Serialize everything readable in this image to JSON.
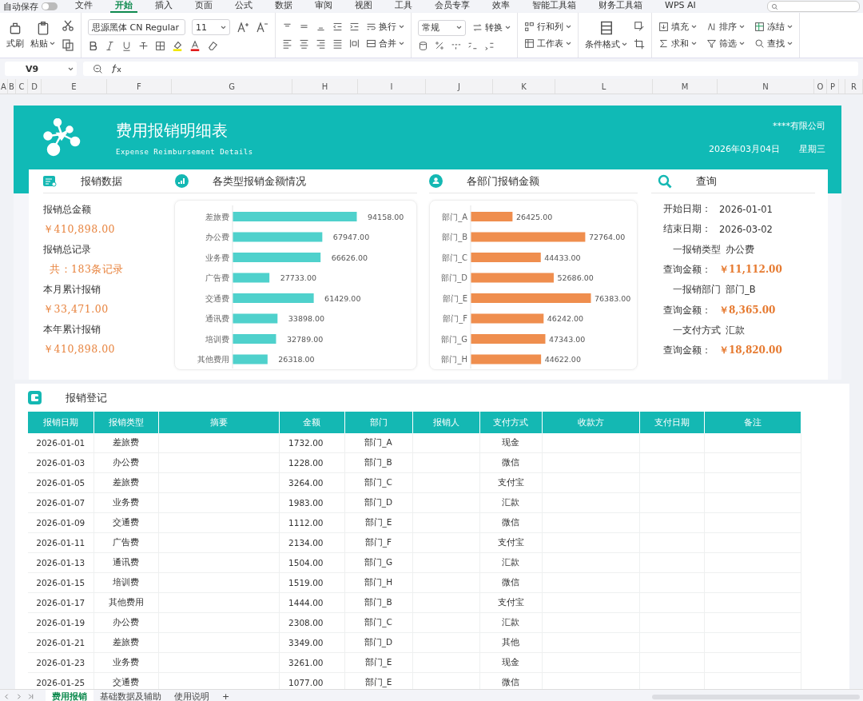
{
  "menu": {
    "autosave": {
      "label": "自动保存",
      "on": false
    },
    "tabs": [
      {
        "label": "文件",
        "selected": false
      },
      {
        "label": "开始",
        "selected": true
      },
      {
        "label": "插入",
        "selected": false
      },
      {
        "label": "页面",
        "selected": false
      },
      {
        "label": "公式",
        "selected": false
      },
      {
        "label": "数据",
        "selected": false
      },
      {
        "label": "审阅",
        "selected": false
      },
      {
        "label": "视图",
        "selected": false
      },
      {
        "label": "工具",
        "selected": false
      },
      {
        "label": "会员专享",
        "selected": false
      },
      {
        "label": "效率",
        "selected": false
      },
      {
        "label": "智能工具箱",
        "selected": false
      },
      {
        "label": "财务工具箱",
        "selected": false
      },
      {
        "label": "WPS AI",
        "selected": false
      }
    ]
  },
  "ribbon": {
    "format_painter": "式刷",
    "paste": "粘贴",
    "font": "思源黑体 CN Regular",
    "size": "11",
    "wrap": "换行",
    "merge": "合并",
    "number_format": "常规",
    "convert": "转换",
    "rows_cols": "行和列",
    "worksheet": "工作表",
    "conditional": "条件格式",
    "fill": "填充",
    "sort": "排序",
    "freeze": "冻结",
    "sum": "求和",
    "filter": "筛选",
    "find": "查找"
  },
  "formula_bar": {
    "cell": "V9"
  },
  "columns": [
    "A",
    "B",
    "C",
    "D",
    "E",
    "F",
    "G",
    "H",
    "I",
    "J",
    "K",
    "L",
    "M",
    "N",
    "O",
    "P",
    "R"
  ],
  "header": {
    "title": "费用报销明细表",
    "subtitle": "Expense Reimbursement Details",
    "company": "****有限公司",
    "date": "2026年03月04日",
    "weekday": "星期三"
  },
  "sections": [
    "报销数据",
    "各类型报销金额情况",
    "各部门报销金额",
    "查询"
  ],
  "stats": [
    {
      "label": "报销总金额",
      "value": "￥410,898.00"
    },
    {
      "label": "报销总记录",
      "value": "共：183条记录"
    },
    {
      "label": "本月累计报销",
      "value": "￥33,471.00"
    },
    {
      "label": "本年累计报销",
      "value": "￥410,898.00"
    }
  ],
  "type_chart": {
    "chart_data": {
      "type": "bar",
      "orientation": "horizontal",
      "categories": [
        "差旅费",
        "办公费",
        "业务费",
        "广告费",
        "交通费",
        "通讯费",
        "培训费",
        "其他费用"
      ],
      "series": [
        {
          "color": "#4fd1cc",
          "values": [
            94158,
            67947,
            66626,
            27733,
            61429,
            33898,
            32789,
            26318
          ],
          "value_labels": [
            "94158.00",
            "67947.00",
            "66626.00",
            "27733.00",
            "61429.00",
            "33898.00",
            "32789.00",
            "26318.00"
          ]
        }
      ]
    }
  },
  "dept_chart": {
    "chart_data": {
      "type": "bar",
      "orientation": "horizontal",
      "categories": [
        "部门_A",
        "部门_B",
        "部门_C",
        "部门_D",
        "部门_E",
        "部门_F",
        "部门_G",
        "部门_H"
      ],
      "series": [
        {
          "color": "#ef8e4e",
          "values": [
            26425,
            72764,
            44433,
            52686,
            76383,
            46242,
            47343,
            44622
          ],
          "value_labels": [
            "26425.00",
            "72764.00",
            "44433.00",
            "52686.00",
            "76383.00",
            "46242.00",
            "47343.00",
            "44622.00"
          ]
        }
      ]
    }
  },
  "query": [
    {
      "kind": "field",
      "label": "开始日期：",
      "value": "2026-01-01"
    },
    {
      "kind": "field",
      "label": "结束日期：",
      "value": "2026-03-02"
    },
    {
      "kind": "filter",
      "label": "一报销类型",
      "value": "办公费"
    },
    {
      "kind": "amount",
      "label": "查询金额：",
      "value": "￥11,112.00"
    },
    {
      "kind": "filter",
      "label": "一报销部门",
      "value": "部门_B"
    },
    {
      "kind": "amount",
      "label": "查询金额：",
      "value": "￥8,365.00"
    },
    {
      "kind": "filter",
      "label": "一支付方式",
      "value": "汇款"
    },
    {
      "kind": "amount",
      "label": "查询金额：",
      "value": "￥18,820.00"
    }
  ],
  "register": {
    "title": "报销登记",
    "columns": [
      "报销日期",
      "报销类型",
      "摘要",
      "金额",
      "部门",
      "报销人",
      "支付方式",
      "收款方",
      "支付日期",
      "备注"
    ],
    "rows": [
      {
        "date": "2026-01-01",
        "type": "差旅费",
        "amount": "1732.00",
        "dept": "部门_A",
        "pay": "现金"
      },
      {
        "date": "2026-01-03",
        "type": "办公费",
        "amount": "1228.00",
        "dept": "部门_B",
        "pay": "微信"
      },
      {
        "date": "2026-01-05",
        "type": "差旅费",
        "amount": "3264.00",
        "dept": "部门_C",
        "pay": "支付宝"
      },
      {
        "date": "2026-01-07",
        "type": "业务费",
        "amount": "1983.00",
        "dept": "部门_D",
        "pay": "汇款"
      },
      {
        "date": "2026-01-09",
        "type": "交通费",
        "amount": "1112.00",
        "dept": "部门_E",
        "pay": "微信"
      },
      {
        "date": "2026-01-11",
        "type": "广告费",
        "amount": "2134.00",
        "dept": "部门_F",
        "pay": "支付宝"
      },
      {
        "date": "2026-01-13",
        "type": "通讯费",
        "amount": "1504.00",
        "dept": "部门_G",
        "pay": "汇款"
      },
      {
        "date": "2026-01-15",
        "type": "培训费",
        "amount": "1519.00",
        "dept": "部门_H",
        "pay": "微信"
      },
      {
        "date": "2026-01-17",
        "type": "其他费用",
        "amount": "1444.00",
        "dept": "部门_B",
        "pay": "支付宝"
      },
      {
        "date": "2026-01-19",
        "type": "办公费",
        "amount": "2308.00",
        "dept": "部门_C",
        "pay": "汇款"
      },
      {
        "date": "2026-01-21",
        "type": "差旅费",
        "amount": "3349.00",
        "dept": "部门_D",
        "pay": "其他"
      },
      {
        "date": "2026-01-23",
        "type": "业务费",
        "amount": "3261.00",
        "dept": "部门_E",
        "pay": "现金"
      },
      {
        "date": "2026-01-25",
        "type": "交通费",
        "amount": "1077.00",
        "dept": "部门_E",
        "pay": "微信"
      }
    ]
  },
  "sheet_tabs": [
    {
      "label": "费用报销",
      "selected": true
    },
    {
      "label": "基础数据及辅助",
      "selected": false
    },
    {
      "label": "使用说明",
      "selected": false
    }
  ],
  "add_sheet": "+"
}
